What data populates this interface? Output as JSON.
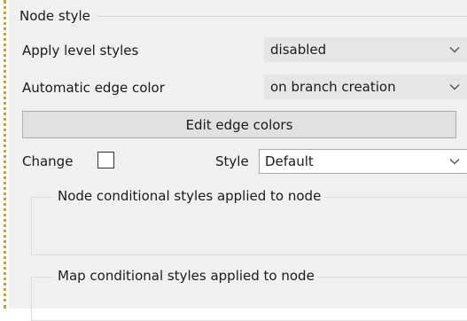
{
  "section": {
    "title": "Node style"
  },
  "apply_level_styles": {
    "label": "Apply level styles",
    "value": "disabled"
  },
  "automatic_edge_color": {
    "label": "Automatic edge color",
    "value": "on branch creation"
  },
  "edit_edge_colors_button": {
    "label": "Edit edge colors"
  },
  "change": {
    "label": "Change",
    "checked": false
  },
  "style": {
    "label": "Style",
    "value": "Default"
  },
  "node_conditional_styles": {
    "label": "Node conditional styles applied to node"
  },
  "map_conditional_styles": {
    "label": "Map conditional styles applied to node"
  },
  "colors": {
    "panel_bg": "#f0f0f0",
    "dotted_border": "#c9a227"
  }
}
